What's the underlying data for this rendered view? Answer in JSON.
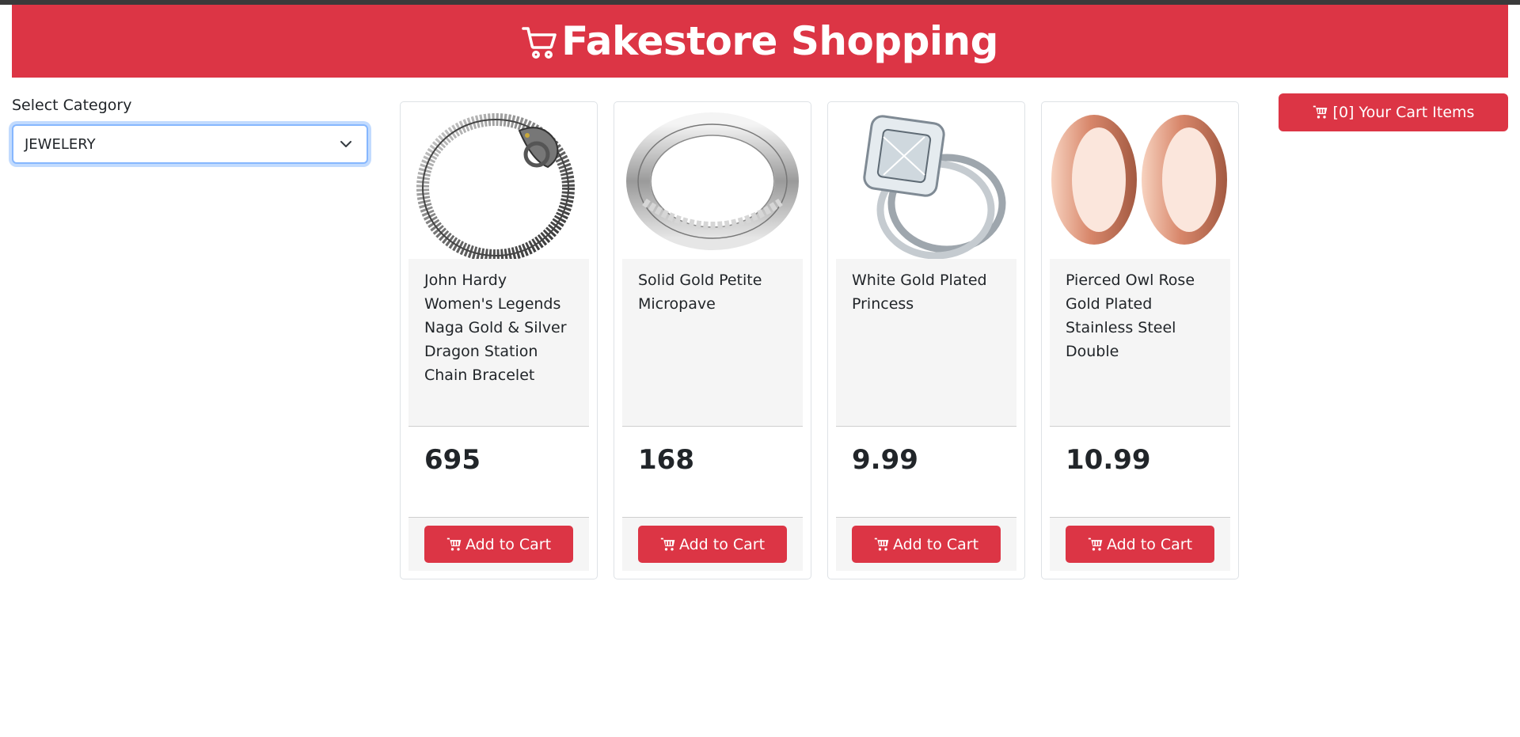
{
  "header": {
    "title": "Fakestore Shopping",
    "icon": "cart-icon"
  },
  "category": {
    "label": "Select Category",
    "selected": "JEWELERY"
  },
  "cart": {
    "label": "[0] Your Cart Items",
    "icon": "cart-icon"
  },
  "colors": {
    "brand": "#dc3545",
    "focus": "#86b7fe"
  },
  "products": [
    {
      "title": "John Hardy Women's Legends Naga Gold & Silver Dragon Station Chain Bracelet",
      "price": "695",
      "button": "Add to Cart",
      "image": "bracelet-image"
    },
    {
      "title": "Solid Gold Petite Micropave",
      "price": "168",
      "button": "Add to Cart",
      "image": "ring-image"
    },
    {
      "title": "White Gold Plated Princess",
      "price": "9.99",
      "button": "Add to Cart",
      "image": "ring-set-image"
    },
    {
      "title": "Pierced Owl Rose Gold Plated Stainless Steel Double",
      "price": "10.99",
      "button": "Add to Cart",
      "image": "tunnel-plug-image"
    }
  ]
}
